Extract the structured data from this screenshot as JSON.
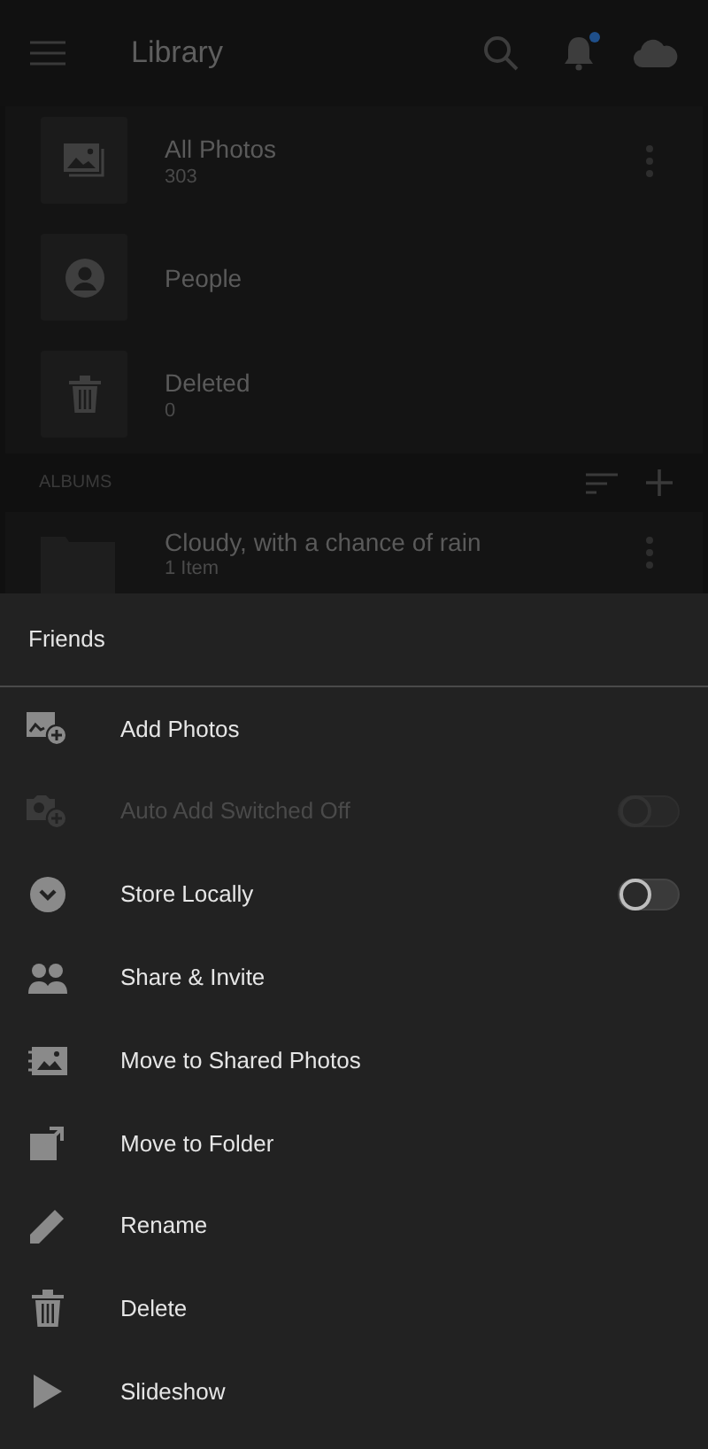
{
  "header": {
    "title": "Library",
    "unread_notifications": true
  },
  "library_items": [
    {
      "kind": "photos",
      "name": "All Photos",
      "count": "303",
      "has_menu": true
    },
    {
      "kind": "people",
      "name": "People",
      "has_menu": false
    },
    {
      "kind": "deleted",
      "name": "Deleted",
      "count": "0",
      "has_menu": false
    }
  ],
  "albums": {
    "heading": "ALBUMS",
    "items": [
      {
        "name": "Cloudy, with a chance of rain",
        "count": "1 Item"
      }
    ]
  },
  "sheet": {
    "title": "Friends",
    "items": [
      {
        "kind": "add-photos",
        "label": "Add Photos",
        "disabled": false
      },
      {
        "kind": "auto-add",
        "label": "Auto Add Switched Off",
        "disabled": true,
        "on": false
      },
      {
        "kind": "store",
        "label": "Store Locally",
        "disabled": false,
        "on": false
      },
      {
        "kind": "share",
        "label": "Share & Invite",
        "disabled": false
      },
      {
        "kind": "shared-photos",
        "label": "Move to Shared Photos",
        "disabled": false
      },
      {
        "kind": "folder",
        "label": "Move to Folder",
        "disabled": false
      },
      {
        "kind": "rename",
        "label": "Rename",
        "disabled": false
      },
      {
        "kind": "delete",
        "label": "Delete",
        "disabled": false
      },
      {
        "kind": "slideshow",
        "label": "Slideshow",
        "disabled": false
      }
    ]
  }
}
